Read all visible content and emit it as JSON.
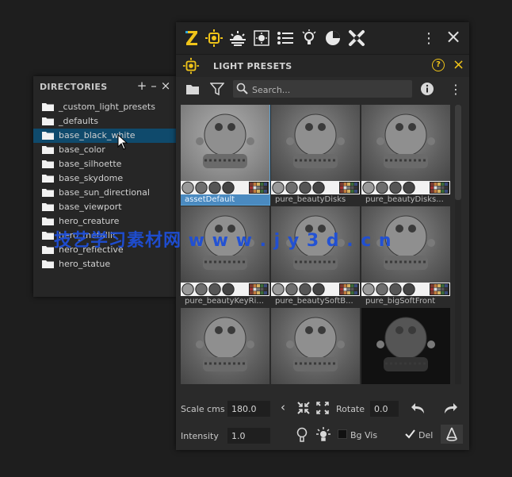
{
  "directories": {
    "title": "DIRECTORIES",
    "add_label": "+",
    "minimize_label": "–",
    "close_label": "×",
    "items": [
      {
        "label": "_custom_light_presets",
        "selected": false
      },
      {
        "label": "_defaults",
        "selected": false
      },
      {
        "label": "base_black_white",
        "selected": true
      },
      {
        "label": "base_color",
        "selected": false
      },
      {
        "label": "base_silhoette",
        "selected": false
      },
      {
        "label": "base_skydome",
        "selected": false
      },
      {
        "label": "base_sun_directional",
        "selected": false
      },
      {
        "label": "base_viewport",
        "selected": false
      },
      {
        "label": "hero_creature",
        "selected": false
      },
      {
        "label": "hero_metallic",
        "selected": false
      },
      {
        "label": "hero_reflective",
        "selected": false
      },
      {
        "label": "hero_statue",
        "selected": false
      }
    ]
  },
  "toolbar": {
    "icons": [
      "z-logo-icon",
      "light-preset-icon",
      "sun-horizon-icon",
      "sun-grid-icon",
      "light-list-icon",
      "bulb-icon",
      "pie-icon",
      "crossed-tools-icon"
    ],
    "more_label": "⋮",
    "close_label": "×"
  },
  "light_presets": {
    "title": "LIGHT PRESETS",
    "help_label": "?",
    "close_label": "×",
    "search": {
      "placeholder": "Search...",
      "value": ""
    },
    "presets": [
      {
        "name": "assetDefault",
        "selected": true,
        "shade": "light"
      },
      {
        "name": "pure_beautyDisks",
        "selected": false,
        "shade": "normal"
      },
      {
        "name": "pure_beautyDisks...",
        "selected": false,
        "shade": "normal"
      },
      {
        "name": "pure_beautyKeyRi...",
        "selected": false,
        "shade": "normal"
      },
      {
        "name": "pure_beautySoftB...",
        "selected": false,
        "shade": "normal"
      },
      {
        "name": "pure_bigSoftFront",
        "selected": false,
        "shade": "normal"
      },
      {
        "name": "",
        "selected": false,
        "shade": "normal"
      },
      {
        "name": "",
        "selected": false,
        "shade": "normal"
      },
      {
        "name": "",
        "selected": false,
        "shade": "dark"
      }
    ]
  },
  "controls": {
    "scale_label": "Scale cms",
    "scale_value": "180.0",
    "rotate_label": "Rotate",
    "rotate_value": "0.0",
    "intensity_label": "Intensity",
    "intensity_value": "1.0",
    "bgvis_label": "Bg Vis",
    "bgvis_checked": false,
    "del_label": "Del",
    "del_checked": true
  },
  "watermark": "技艺学习素材网 w w w . j y 3 d . c n",
  "colors": {
    "accent": "#f0c419",
    "selection": "#0f4a6c",
    "watermark": "#1e4fd8"
  }
}
